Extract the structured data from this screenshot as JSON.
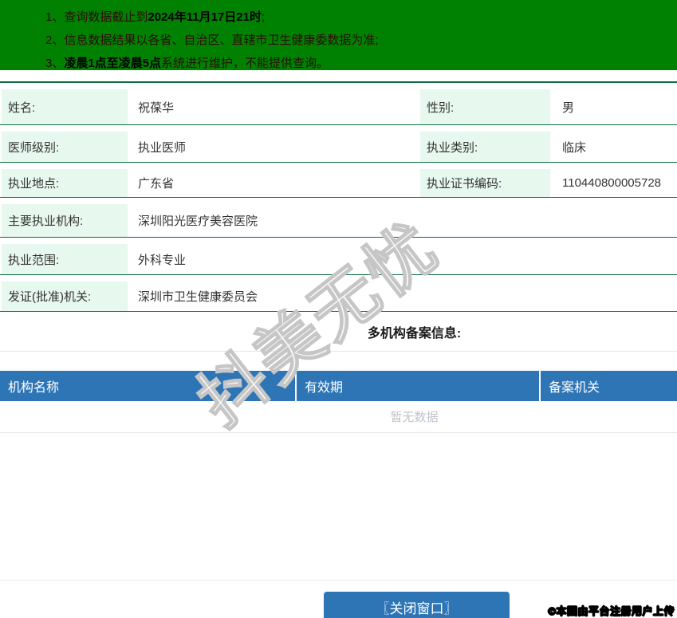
{
  "colors": {
    "banner_green": "#018101",
    "table_border_green": "#0a6c3e",
    "label_mint": "#e7f8ef",
    "accent_blue": "#2e75b6",
    "empty_text_gray": "#bfc3cb"
  },
  "notices": {
    "n1": {
      "num": "1、",
      "pre": "查询数据截止到",
      "bold": "2024年11月17日21时",
      "tail": ";"
    },
    "n2": {
      "num": "2、",
      "pre": "信息数据结果以各省、自治区、直辖市卫生健康委数据为准;",
      "bold": "",
      "tail": ""
    },
    "n3": {
      "num": "3、",
      "pre": "",
      "bold": "凌晨1点至凌晨5点",
      "tail": "系统进行维护，不能提供查询。"
    }
  },
  "info": {
    "rows4": [
      {
        "l1": "姓名:",
        "v1": "祝葆华",
        "l2": "性别:",
        "v2": "男"
      },
      {
        "l1": "医师级别:",
        "v1": "执业医师",
        "l2": "执业类别:",
        "v2": "临床"
      },
      {
        "l1": "执业地点:",
        "v1": "广东省",
        "l2": "执业证书编码:",
        "v2": "110440800005728"
      }
    ],
    "rows2": [
      {
        "l1": "主要执业机构:",
        "v1": "深圳阳光医疗美容医院"
      },
      {
        "l1": "执业范围:",
        "v1": "外科专业"
      },
      {
        "l1": "发证(批准)机关:",
        "v1": "深圳市卫生健康委员会"
      }
    ],
    "section_title": "多机构备案信息:"
  },
  "filing": {
    "headers": [
      "机构名称",
      "有效期",
      "备案机关"
    ],
    "empty_text": "暂无数据"
  },
  "watermark": {
    "text": "抖美无忧"
  },
  "footer": {
    "close_label": "〖关闭窗口〗",
    "copyright": "©本图由平台注册用户上传"
  }
}
